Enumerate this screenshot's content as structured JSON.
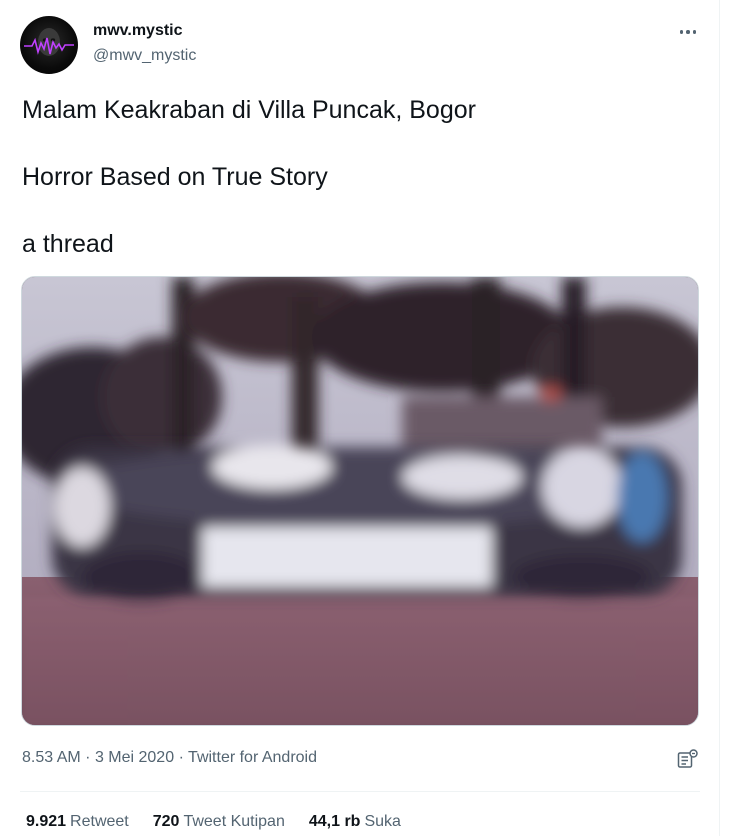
{
  "author": {
    "display_name": "mwv.mystic",
    "handle": "@mwv_mystic",
    "avatar_icon": "waveform-avatar"
  },
  "tweet": {
    "lines": [
      "Malam Keakraban di Villa Puncak, Bogor",
      "Horror Based on True Story",
      "a thread"
    ],
    "media_icon": "group-photo-image"
  },
  "meta": {
    "time": "8.53 AM",
    "separator1": "·",
    "date": "3 Mei 2020",
    "separator2": "·",
    "source": "Twitter for Android"
  },
  "stats": {
    "retweets_count": "9.921",
    "retweets_label": "Retweet",
    "quotes_count": "720",
    "quotes_label": "Tweet Kutipan",
    "likes_count": "44,1 rb",
    "likes_label": "Suka"
  },
  "colors": {
    "text_primary": "#0f1419",
    "text_secondary": "#536471",
    "divider": "#eff3f4",
    "border": "#cfd9de"
  }
}
